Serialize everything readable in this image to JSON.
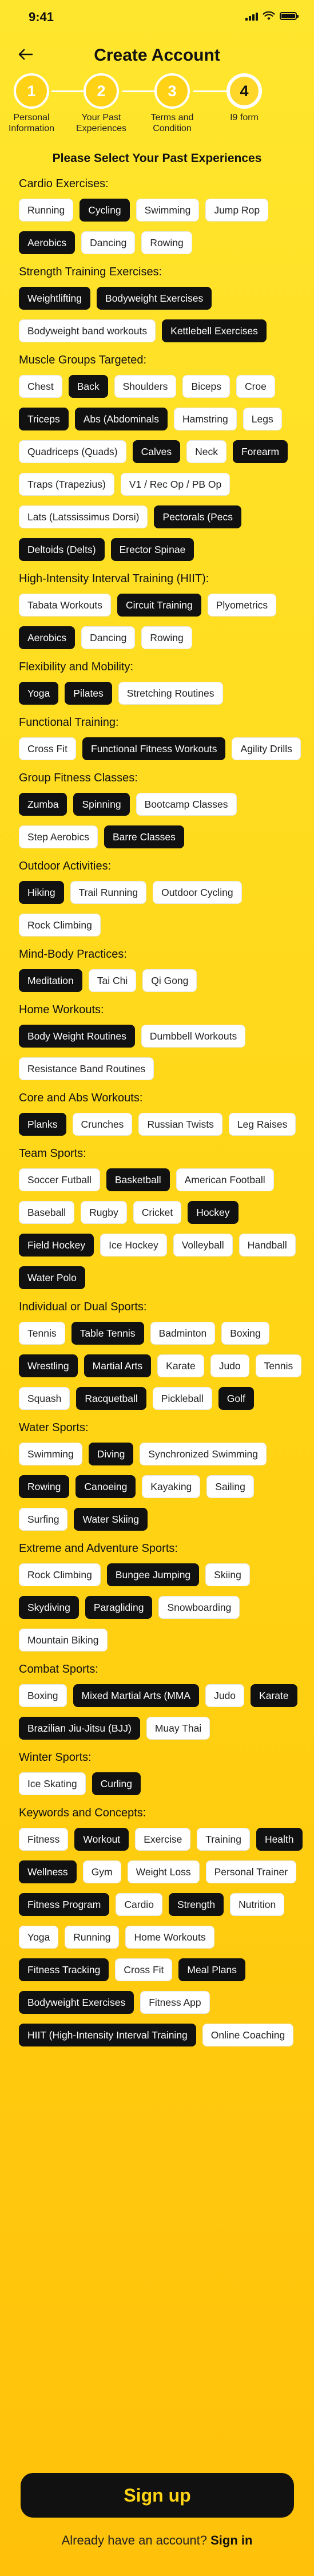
{
  "status": {
    "time": "9:41"
  },
  "header": {
    "title": "Create Account"
  },
  "steps": [
    {
      "number": "1",
      "label": "Personal Information",
      "state": "done"
    },
    {
      "number": "2",
      "label": "Your Past Experiences",
      "state": "done"
    },
    {
      "number": "3",
      "label": "Terms and Condition",
      "state": "done"
    },
    {
      "number": "4",
      "label": "I9 form",
      "state": "current"
    }
  ],
  "subtitle": "Please Select Your Past Experiences",
  "sections": [
    {
      "title": "Cardio Exercises:",
      "chips": [
        {
          "label": "Running",
          "selected": false
        },
        {
          "label": "Cycling",
          "selected": true
        },
        {
          "label": "Swimming",
          "selected": false
        },
        {
          "label": "Jump Rop",
          "selected": false
        },
        {
          "label": "Aerobics",
          "selected": true
        },
        {
          "label": "Dancing",
          "selected": false
        },
        {
          "label": "Rowing",
          "selected": false
        }
      ]
    },
    {
      "title": "Strength Training Exercises:",
      "chips": [
        {
          "label": "Weightlifting",
          "selected": true
        },
        {
          "label": "Bodyweight Exercises",
          "selected": true
        },
        {
          "label": "Bodyweight band workouts",
          "selected": false
        },
        {
          "label": "Kettlebell Exercises",
          "selected": true
        }
      ]
    },
    {
      "title": "Muscle Groups Targeted:",
      "chips": [
        {
          "label": "Chest",
          "selected": false
        },
        {
          "label": "Back",
          "selected": true
        },
        {
          "label": "Shoulders",
          "selected": false
        },
        {
          "label": "Biceps",
          "selected": false
        },
        {
          "label": "Croe",
          "selected": false
        },
        {
          "label": "Triceps",
          "selected": true
        },
        {
          "label": "Abs (Abdominals",
          "selected": true
        },
        {
          "label": "Hamstring",
          "selected": false
        },
        {
          "label": "Legs",
          "selected": false
        },
        {
          "label": "Quadriceps (Quads)",
          "selected": false
        },
        {
          "label": "Calves",
          "selected": true
        },
        {
          "label": "Neck",
          "selected": false
        },
        {
          "label": "Forearm",
          "selected": true
        },
        {
          "label": "Traps (Trapezius)",
          "selected": false
        },
        {
          "label": "V1 / Rec Op / PB Op",
          "selected": false
        },
        {
          "label": "Lats (Latssissimus Dorsi)",
          "selected": false
        },
        {
          "label": "Pectorals (Pecs",
          "selected": true
        },
        {
          "label": "Deltoids (Delts)",
          "selected": true
        },
        {
          "label": "Erector Spinae",
          "selected": true
        }
      ]
    },
    {
      "title": "High-Intensity Interval Training (HIIT):",
      "chips": [
        {
          "label": "Tabata Workouts",
          "selected": false
        },
        {
          "label": "Circuit Training",
          "selected": true
        },
        {
          "label": "Plyometrics",
          "selected": false
        },
        {
          "label": "Aerobics",
          "selected": true
        },
        {
          "label": "Dancing",
          "selected": false
        },
        {
          "label": "Rowing",
          "selected": false
        }
      ]
    },
    {
      "title": "Flexibility and Mobility:",
      "chips": [
        {
          "label": "Yoga",
          "selected": true
        },
        {
          "label": "Pilates",
          "selected": true
        },
        {
          "label": "Stretching Routines",
          "selected": false
        }
      ]
    },
    {
      "title": "Functional Training:",
      "chips": [
        {
          "label": "Cross Fit",
          "selected": false
        },
        {
          "label": "Functional Fitness Workouts",
          "selected": true
        },
        {
          "label": "Agility Drills",
          "selected": false
        }
      ]
    },
    {
      "title": "Group Fitness Classes:",
      "chips": [
        {
          "label": "Zumba",
          "selected": true
        },
        {
          "label": "Spinning",
          "selected": true
        },
        {
          "label": "Bootcamp Classes",
          "selected": false
        },
        {
          "label": "Step Aerobics",
          "selected": false
        },
        {
          "label": "Barre Classes",
          "selected": true
        }
      ]
    },
    {
      "title": "Outdoor Activities:",
      "chips": [
        {
          "label": "Hiking",
          "selected": true
        },
        {
          "label": "Trail Running",
          "selected": false
        },
        {
          "label": "Outdoor Cycling",
          "selected": false
        },
        {
          "label": "Rock Climbing",
          "selected": false
        }
      ]
    },
    {
      "title": "Mind-Body Practices:",
      "chips": [
        {
          "label": "Meditation",
          "selected": true
        },
        {
          "label": "Tai Chi",
          "selected": false
        },
        {
          "label": "Qi Gong",
          "selected": false
        }
      ]
    },
    {
      "title": "Home Workouts:",
      "chips": [
        {
          "label": "Body Weight Routines",
          "selected": true
        },
        {
          "label": "Dumbbell Workouts",
          "selected": false
        },
        {
          "label": "Resistance Band Routines",
          "selected": false
        }
      ]
    },
    {
      "title": "Core and Abs Workouts:",
      "chips": [
        {
          "label": "Planks",
          "selected": true
        },
        {
          "label": "Crunches",
          "selected": false
        },
        {
          "label": "Russian Twists",
          "selected": false
        },
        {
          "label": "Leg Raises",
          "selected": false
        }
      ]
    },
    {
      "title": "Team Sports:",
      "chips": [
        {
          "label": "Soccer Futball",
          "selected": false
        },
        {
          "label": "Basketball",
          "selected": true
        },
        {
          "label": "American Football",
          "selected": false
        },
        {
          "label": "Baseball",
          "selected": false
        },
        {
          "label": "Rugby",
          "selected": false
        },
        {
          "label": "Cricket",
          "selected": false
        },
        {
          "label": "Hockey",
          "selected": true
        },
        {
          "label": "Field Hockey",
          "selected": true
        },
        {
          "label": "Ice Hockey",
          "selected": false
        },
        {
          "label": "Volleyball",
          "selected": false
        },
        {
          "label": "Handball",
          "selected": false
        },
        {
          "label": "Water Polo",
          "selected": true
        }
      ]
    },
    {
      "title": "Individual or Dual Sports:",
      "chips": [
        {
          "label": "Tennis",
          "selected": false
        },
        {
          "label": "Table Tennis",
          "selected": true
        },
        {
          "label": "Badminton",
          "selected": false
        },
        {
          "label": "Boxing",
          "selected": false
        },
        {
          "label": "Wrestling",
          "selected": true
        },
        {
          "label": "Martial Arts",
          "selected": true
        },
        {
          "label": "Karate",
          "selected": false
        },
        {
          "label": "Judo",
          "selected": false
        },
        {
          "label": "Tennis",
          "selected": false
        },
        {
          "label": "Squash",
          "selected": false
        },
        {
          "label": "Racquetball",
          "selected": true
        },
        {
          "label": "Pickleball",
          "selected": false
        },
        {
          "label": "Golf",
          "selected": true
        }
      ]
    },
    {
      "title": "Water Sports:",
      "chips": [
        {
          "label": "Swimming",
          "selected": false
        },
        {
          "label": "Diving",
          "selected": true
        },
        {
          "label": "Synchronized Swimming",
          "selected": false
        },
        {
          "label": "Rowing",
          "selected": true
        },
        {
          "label": "Canoeing",
          "selected": true
        },
        {
          "label": "Kayaking",
          "selected": false
        },
        {
          "label": "Sailing",
          "selected": false
        },
        {
          "label": "Surfing",
          "selected": false
        },
        {
          "label": "Water Skiing",
          "selected": true
        }
      ]
    },
    {
      "title": "Extreme and Adventure Sports:",
      "chips": [
        {
          "label": "Rock Climbing",
          "selected": false
        },
        {
          "label": "Bungee Jumping",
          "selected": true
        },
        {
          "label": "Skiing",
          "selected": false
        },
        {
          "label": "Skydiving",
          "selected": true
        },
        {
          "label": "Paragliding",
          "selected": true
        },
        {
          "label": "Snowboarding",
          "selected": false
        },
        {
          "label": "Mountain Biking",
          "selected": false
        }
      ]
    },
    {
      "title": "Combat Sports:",
      "chips": [
        {
          "label": "Boxing",
          "selected": false
        },
        {
          "label": "Mixed Martial Arts (MMA",
          "selected": true
        },
        {
          "label": "Judo",
          "selected": false
        },
        {
          "label": "Karate",
          "selected": true
        },
        {
          "label": "Brazilian Jiu-Jitsu (BJJ)",
          "selected": true
        },
        {
          "label": "Muay Thai",
          "selected": false
        }
      ]
    },
    {
      "title": "Winter Sports:",
      "chips": [
        {
          "label": "Ice Skating",
          "selected": false
        },
        {
          "label": "Curling",
          "selected": true
        }
      ]
    },
    {
      "title": "Keywords and Concepts:",
      "chips": [
        {
          "label": "Fitness",
          "selected": false
        },
        {
          "label": "Workout",
          "selected": true
        },
        {
          "label": "Exercise",
          "selected": false
        },
        {
          "label": "Training",
          "selected": false
        },
        {
          "label": "Health",
          "selected": true
        },
        {
          "label": "Wellness",
          "selected": true
        },
        {
          "label": "Gym",
          "selected": false
        },
        {
          "label": "Weight Loss",
          "selected": false
        },
        {
          "label": "Personal Trainer",
          "selected": false
        },
        {
          "label": "Fitness Program",
          "selected": true
        },
        {
          "label": "Cardio",
          "selected": false
        },
        {
          "label": "Strength",
          "selected": true
        },
        {
          "label": "Nutrition",
          "selected": false
        },
        {
          "label": "Yoga",
          "selected": false
        },
        {
          "label": "Running",
          "selected": false
        },
        {
          "label": "Home Workouts",
          "selected": false
        },
        {
          "label": "Fitness Tracking",
          "selected": true
        },
        {
          "label": "Cross Fit",
          "selected": false
        },
        {
          "label": "Meal Plans",
          "selected": true
        },
        {
          "label": "Bodyweight Exercises",
          "selected": true
        },
        {
          "label": "Fitness App",
          "selected": false
        },
        {
          "label": "HIIT (High-Intensity Interval Training",
          "selected": true
        },
        {
          "label": "Online Coaching",
          "selected": false
        }
      ]
    }
  ],
  "footer": {
    "signup_label": "Sign up",
    "signin_prompt": "Already have an account?",
    "signin_link": "Sign in"
  }
}
